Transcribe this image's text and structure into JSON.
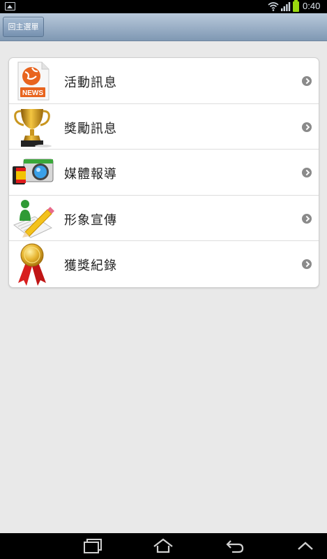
{
  "status_bar": {
    "time": "0:40"
  },
  "header": {
    "back_label": "回主選單"
  },
  "menu": {
    "items": [
      {
        "label": "活動訊息",
        "icon": "news-icon"
      },
      {
        "label": "獎勵訊息",
        "icon": "trophy-icon"
      },
      {
        "label": "媒體報導",
        "icon": "camera-film-icon"
      },
      {
        "label": "形象宣傳",
        "icon": "pencil-person-icon"
      },
      {
        "label": "獲獎紀錄",
        "icon": "medal-ribbon-icon"
      }
    ]
  },
  "nav_bar": {
    "icons": [
      "recent-apps-icon",
      "home-icon",
      "back-icon",
      "menu-up-icon"
    ]
  }
}
